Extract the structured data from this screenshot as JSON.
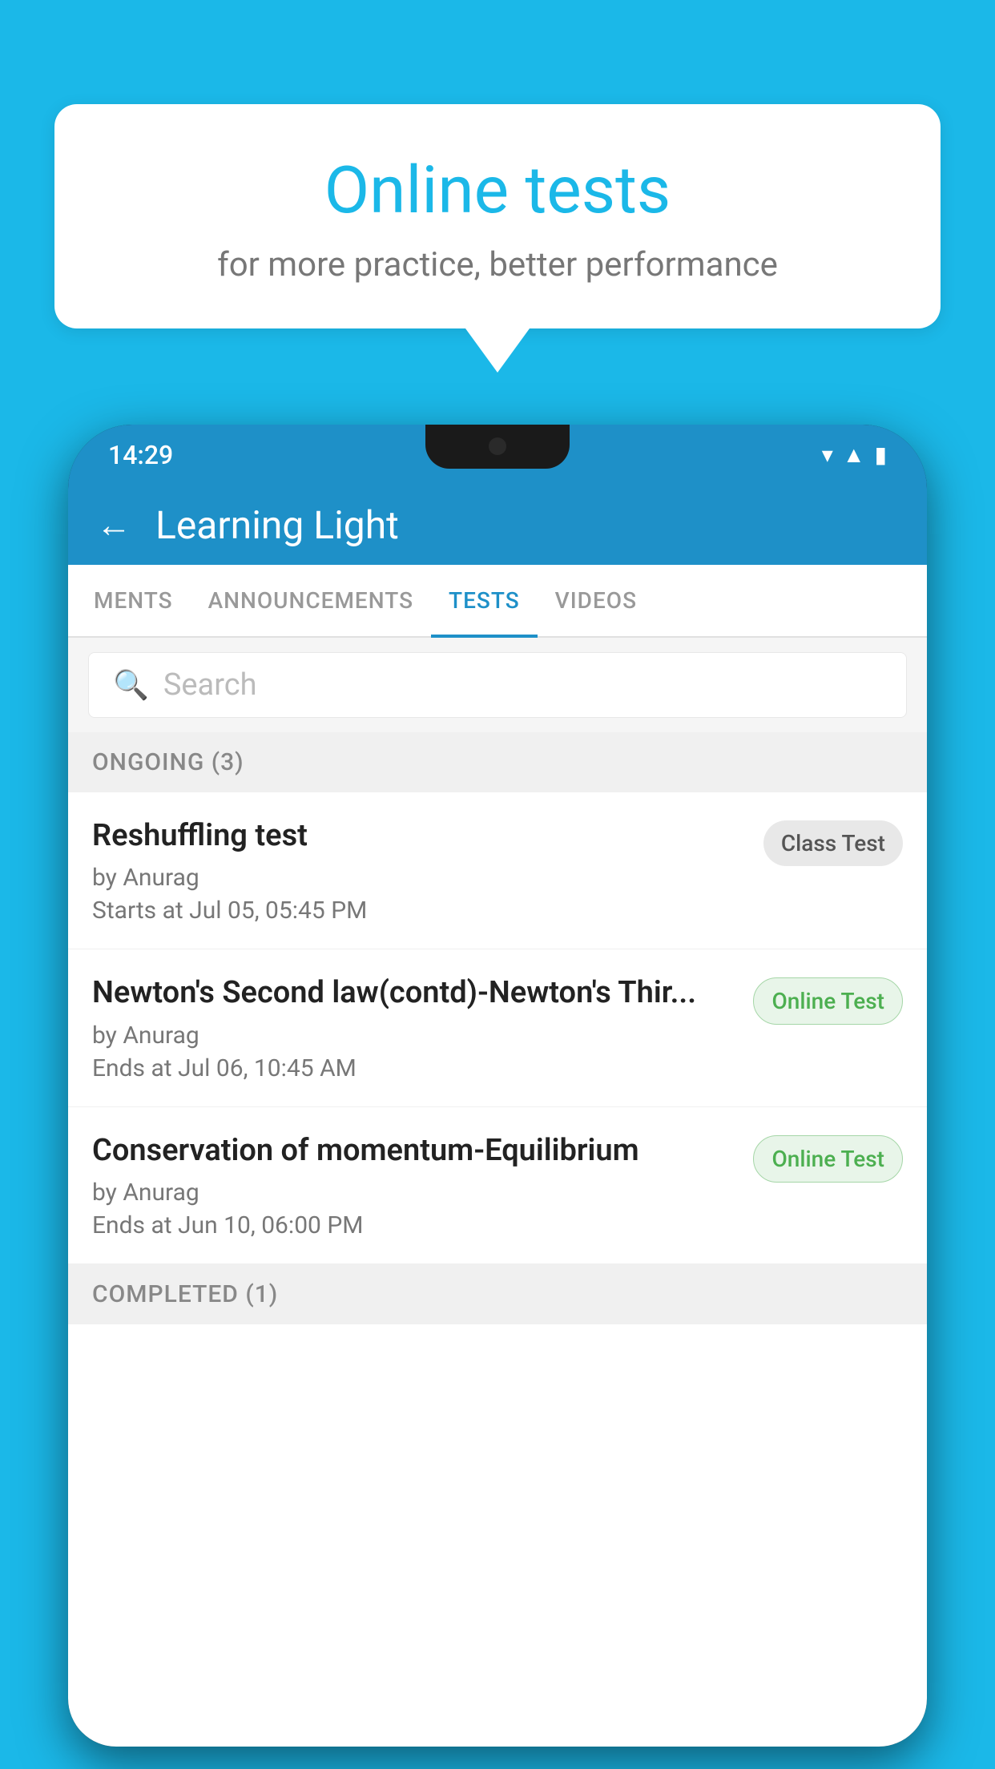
{
  "background_color": "#1bb8e8",
  "speech_bubble": {
    "title": "Online tests",
    "subtitle": "for more practice, better performance"
  },
  "phone": {
    "status_bar": {
      "time": "14:29",
      "icons": [
        "wifi",
        "signal",
        "battery"
      ]
    },
    "header": {
      "back_label": "←",
      "title": "Learning Light"
    },
    "tabs": [
      {
        "label": "MENTS",
        "active": false
      },
      {
        "label": "ANNOUNCEMENTS",
        "active": false
      },
      {
        "label": "TESTS",
        "active": true
      },
      {
        "label": "VIDEOS",
        "active": false
      }
    ],
    "search": {
      "placeholder": "Search"
    },
    "ongoing_section": {
      "label": "ONGOING (3)"
    },
    "tests": [
      {
        "name": "Reshuffling test",
        "author": "by Anurag",
        "time": "Starts at  Jul 05, 05:45 PM",
        "badge": "Class Test",
        "badge_type": "class"
      },
      {
        "name": "Newton's Second law(contd)-Newton's Thir...",
        "author": "by Anurag",
        "time": "Ends at  Jul 06, 10:45 AM",
        "badge": "Online Test",
        "badge_type": "online"
      },
      {
        "name": "Conservation of momentum-Equilibrium",
        "author": "by Anurag",
        "time": "Ends at  Jun 10, 06:00 PM",
        "badge": "Online Test",
        "badge_type": "online"
      }
    ],
    "completed_section": {
      "label": "COMPLETED (1)"
    }
  }
}
